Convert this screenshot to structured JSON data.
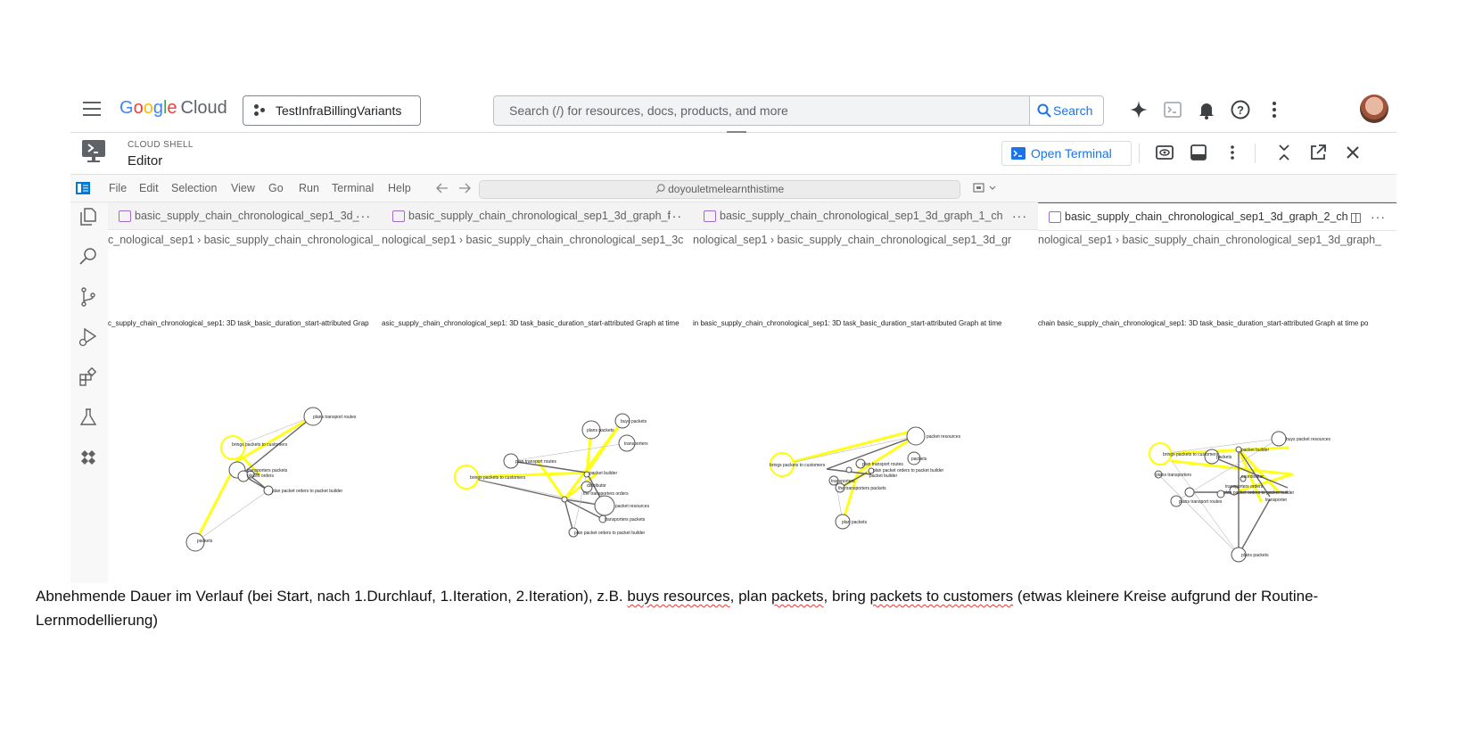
{
  "topbar": {
    "logo_parts": [
      "G",
      "o",
      "o",
      "g",
      "l",
      "e"
    ],
    "logo_cloud": "Cloud",
    "project": "TestInfraBillingVariants",
    "search_placeholder": "Search (/) for resources, docs, products, and more",
    "search_button": "Search",
    "icons": [
      "gemini-icon",
      "cloud-shell-icon",
      "bell-icon",
      "help-icon",
      "more-vert-icon",
      "avatar"
    ]
  },
  "cloudshell": {
    "label": "CLOUD SHELL",
    "title": "Editor",
    "open_terminal": "Open Terminal"
  },
  "menubar": {
    "items": [
      "File",
      "Edit",
      "Selection",
      "View",
      "Go",
      "Run",
      "Terminal",
      "Help"
    ],
    "command_center": "doyouletmelearnthistime"
  },
  "groups": [
    {
      "tab": "basic_supply_chain_chronological_sep1_3d_",
      "crumb_folder": "c_nological_sep1",
      "crumb_file": "basic_supply_chain_chronological_",
      "chart_title": "c_supply_chain_chronological_sep1: 3D task_basic_duration_start-attributed Grap",
      "labels": [
        "plans transport routes",
        "brings packets to customers",
        "plan packet orders to packet builder",
        "transporters packets",
        "places orders",
        "packets"
      ]
    },
    {
      "tab": "basic_supply_chain_chronological_sep1_3d_graph_f",
      "crumb_folder": "nological_sep1",
      "crumb_file": "basic_supply_chain_chronological_sep1_3c",
      "chart_title": "asic_supply_chain_chronological_sep1: 3D task_basic_duration_start-attributed Graph at time",
      "labels": [
        "buys packets",
        "plans packets",
        "transporters",
        "plan transport routes",
        "packet builder",
        "brings packets to customers",
        "distributor",
        "the transporters orders",
        "packet resources",
        "transporters packets",
        "plan packet orders to packet builder"
      ]
    },
    {
      "tab": "basic_supply_chain_chronological_sep1_3d_graph_1_ch",
      "crumb_folder": "nological_sep1",
      "crumb_file": "basic_supply_chain_chronological_sep1_3d_gr",
      "chart_title": "in basic_supply_chain_chronological_sep1: 3D task_basic_duration_start-attributed Graph at time",
      "labels": [
        "packet resources",
        "brings packets to customers",
        "plan transport routes",
        "packets",
        "plan packet orders to packet builder",
        "packet builder",
        "transporters",
        "the transporters packets",
        "plan packets"
      ]
    },
    {
      "tab": "basic_supply_chain_chronological_sep1_3d_graph_2_ch",
      "crumb_folder": "nological_sep1",
      "crumb_file": "basic_supply_chain_chronological_sep1_3d_graph_",
      "chart_title": "chain basic_supply_chain_chronological_sep1: 3D task_basic_duration_start-attributed Graph at time po",
      "labels": [
        "buys packet resources",
        "packet builder",
        "brings packets to customers",
        "packets",
        "coordinator",
        "plans transporters",
        "transporters orders",
        "plan packet orders to packet builder",
        "transporter",
        "plans transport routes",
        "plans packets"
      ]
    }
  ],
  "caption": {
    "part1": "Abnehmende Dauer im Verlauf (bei Start, nach 1.Durchlauf, 1.Iteration, 2.Iteration), z.B. ",
    "w1": "buys resources",
    "part2": ", plan ",
    "w2": "packets",
    "part3": ", bring ",
    "w3": "packets to customers",
    "part4": " (etwas kleinere Kreise aufgrund der Routine-Lernmodellierung)"
  },
  "colors": {
    "accent": "#1a73e8",
    "highlight": "#ffff00",
    "node": "#555555"
  }
}
